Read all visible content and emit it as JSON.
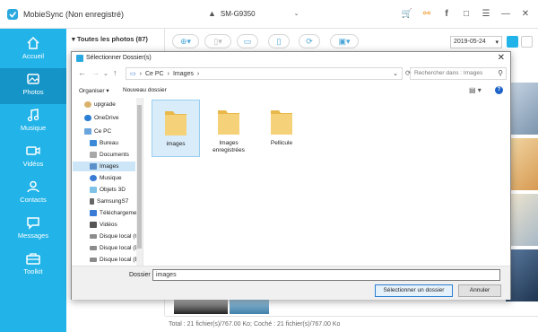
{
  "app": {
    "title": "MobieSync (Non enregistré)",
    "device": "SM-G9350",
    "accent": "#22b4e8",
    "title_icons": [
      "cart-icon",
      "key-icon",
      "facebook-icon",
      "chat-icon",
      "menu-icon",
      "minimize-icon",
      "close-icon"
    ]
  },
  "sidebar": {
    "items": [
      {
        "label": "Accueil",
        "icon": "home-icon"
      },
      {
        "label": "Photos",
        "icon": "photo-icon",
        "active": true
      },
      {
        "label": "Musique",
        "icon": "music-icon"
      },
      {
        "label": "Vidéos",
        "icon": "video-icon"
      },
      {
        "label": "Contacts",
        "icon": "contacts-icon"
      },
      {
        "label": "Messages",
        "icon": "messages-icon"
      },
      {
        "label": "Toolkit",
        "icon": "toolkit-icon"
      }
    ]
  },
  "main": {
    "album_header": "Toutes les photos (87)",
    "date": "2019-05-24",
    "status": "Total : 21 fichier(s)/767.00 Ko; Coché : 21 fichier(s)/767.00 Ko"
  },
  "dialog": {
    "title": "Sélectionner Dossier(s)",
    "breadcrumb": [
      "Ce PC",
      "Images"
    ],
    "search_placeholder": "Rechercher dans : Images",
    "organize": "Organiser",
    "new_folder": "Nouveau dossier",
    "tree": [
      {
        "label": "upgrade",
        "icon": "user-icon"
      },
      {
        "label": "OneDrive",
        "icon": "onedrive-icon"
      },
      {
        "label": "Ce PC",
        "icon": "pc-icon"
      },
      {
        "label": "Bureau",
        "icon": "desktop-icon"
      },
      {
        "label": "Documents",
        "icon": "documents-icon"
      },
      {
        "label": "Images",
        "icon": "images-icon",
        "selected": true
      },
      {
        "label": "Musique",
        "icon": "music-folder-icon"
      },
      {
        "label": "Objets 3D",
        "icon": "objects3d-icon"
      },
      {
        "label": "SamsungS7",
        "icon": "phone-icon"
      },
      {
        "label": "Téléchargement",
        "icon": "download-icon"
      },
      {
        "label": "Vidéos",
        "icon": "video-folder-icon"
      },
      {
        "label": "Disque local (C:)",
        "icon": "drive-icon"
      },
      {
        "label": "Disque local (D:)",
        "icon": "drive-icon"
      },
      {
        "label": "Disque local (E:)",
        "icon": "drive-icon"
      }
    ],
    "folders": [
      {
        "label": "images",
        "selected": true
      },
      {
        "label": "Images enregistrées"
      },
      {
        "label": "Pellicule"
      }
    ],
    "folder_field_label": "Dossier :",
    "folder_field_value": "images",
    "ok_label": "Sélectionner un dossier",
    "cancel_label": "Annuler"
  }
}
